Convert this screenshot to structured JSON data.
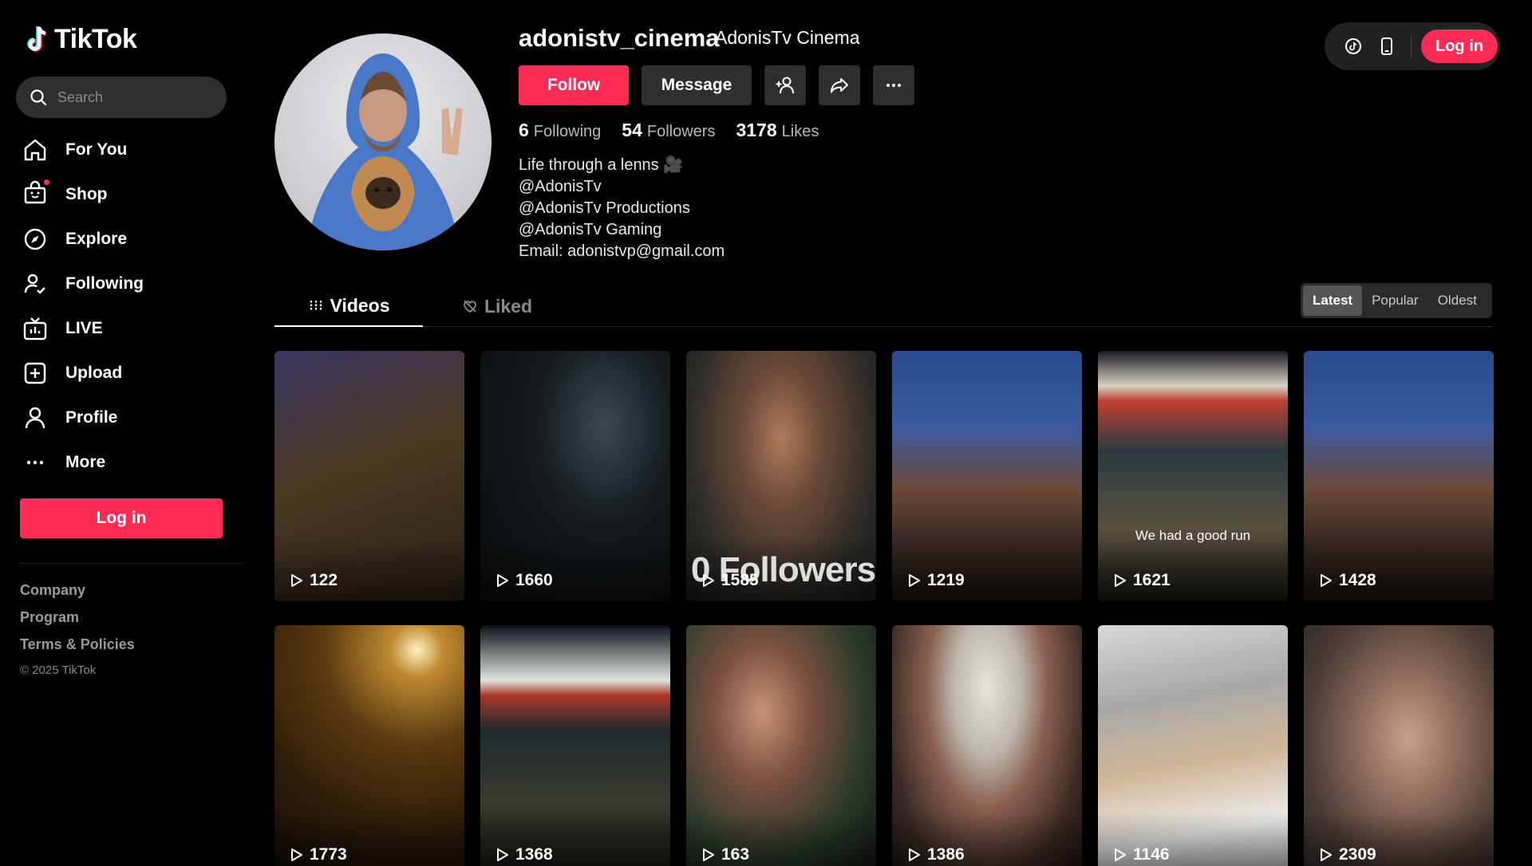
{
  "brand": {
    "name": "TikTok"
  },
  "search": {
    "placeholder": "Search"
  },
  "sidebar": {
    "items": [
      {
        "label": "For You",
        "icon": "home-icon"
      },
      {
        "label": "Shop",
        "icon": "shop-bag-icon"
      },
      {
        "label": "Explore",
        "icon": "compass-icon"
      },
      {
        "label": "Following",
        "icon": "following-icon"
      },
      {
        "label": "LIVE",
        "icon": "live-tv-icon"
      },
      {
        "label": "Upload",
        "icon": "upload-plus-icon"
      },
      {
        "label": "Profile",
        "icon": "profile-icon"
      },
      {
        "label": "More",
        "icon": "more-dots-icon"
      }
    ],
    "login_label": "Log in",
    "footer": {
      "company": "Company",
      "program": "Program",
      "terms": "Terms & Policies",
      "copyright": "© 2025 TikTok"
    }
  },
  "topbar": {
    "login_label": "Log in"
  },
  "profile": {
    "username": "adonistv_cinema",
    "display_name": "AdonisTv Cinema",
    "follow_label": "Follow",
    "message_label": "Message",
    "stats": {
      "following_count": "6",
      "following_label": "Following",
      "followers_count": "54",
      "followers_label": "Followers",
      "likes_count": "3178",
      "likes_label": "Likes"
    },
    "bio": [
      "Life through a lenns 🎥",
      "@AdonisTv",
      "@AdonisTv Productions",
      "@AdonisTv Gaming",
      "Email: adonistvp@gmail.com"
    ]
  },
  "tabs": {
    "videos": "Videos",
    "liked": "Liked"
  },
  "sort": {
    "latest": "Latest",
    "popular": "Popular",
    "oldest": "Oldest",
    "selected": "Latest"
  },
  "videos": [
    {
      "views": "122",
      "caption": "",
      "overlay": ""
    },
    {
      "views": "1660",
      "caption": "",
      "overlay": ""
    },
    {
      "views": "1585",
      "caption": "",
      "overlay": "0 Followers"
    },
    {
      "views": "1219",
      "caption": "",
      "overlay": ""
    },
    {
      "views": "1621",
      "caption": "We had a good run",
      "overlay": ""
    },
    {
      "views": "1428",
      "caption": "",
      "overlay": ""
    },
    {
      "views": "1773",
      "caption": "",
      "overlay": ""
    },
    {
      "views": "1368",
      "caption": "",
      "overlay": ""
    },
    {
      "views": "163",
      "caption": "",
      "overlay": ""
    },
    {
      "views": "1386",
      "caption": "",
      "overlay": ""
    },
    {
      "views": "1146",
      "caption": "",
      "overlay": ""
    },
    {
      "views": "2309",
      "caption": "",
      "overlay": ""
    }
  ],
  "colors": {
    "accent": "#fe2c55",
    "background": "#000000",
    "surface": "#2f2f2f"
  }
}
